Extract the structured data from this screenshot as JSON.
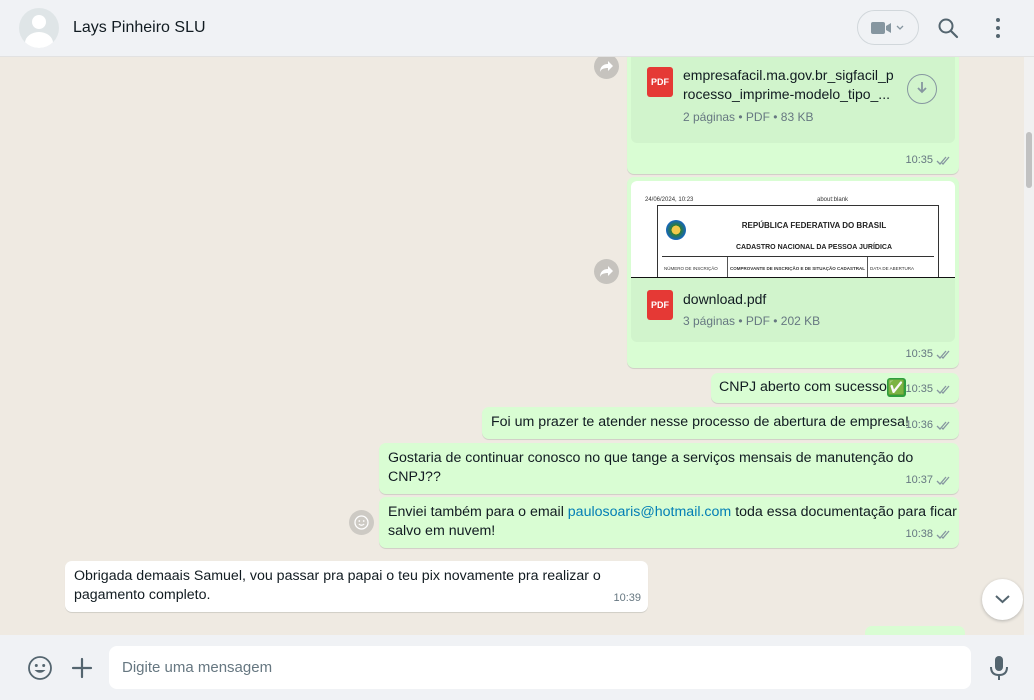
{
  "header": {
    "contact_name": "Lays Pinheiro SLU",
    "icons": [
      "avatar-icon",
      "video-call-icon",
      "search-icon",
      "menu-icon"
    ]
  },
  "messages": [
    {
      "type": "document",
      "direction": "outgoing",
      "file_name_line1": "empresafacil.ma.gov.br_sigfacil_p",
      "file_name_line2": "rocesso_imprime-modelo_tipo_...",
      "file_icon_label": "PDF",
      "file_info": "2 páginas • PDF • 83 KB",
      "time": "10:35"
    },
    {
      "type": "document",
      "direction": "outgoing",
      "preview": {
        "date": "24/06/2024, 10:23",
        "about": "about:blank",
        "title1": "REPÚBLICA FEDERATIVA DO BRASIL",
        "title2": "CADASTRO NACIONAL DA PESSOA JURÍDICA",
        "cell1": "NÚMERO DE INSCRIÇÃO 55.844.422/0001-88 MATRIZ",
        "cell2": "COMPROVANTE DE INSCRIÇÃO E DE SITUAÇÃO CADASTRAL",
        "cell3": "DATA DE ABERTURA 24/06/2024"
      },
      "file_name": "download.pdf",
      "file_icon_label": "PDF",
      "file_info": "3 páginas • PDF • 202 KB",
      "time": "10:35"
    },
    {
      "type": "text",
      "direction": "outgoing",
      "text": "CNPJ aberto com sucesso",
      "emoji": "✅",
      "time": "10:35"
    },
    {
      "type": "text",
      "direction": "outgoing",
      "text": "Foi um prazer te atender nesse processo de abertura de empresa!",
      "time": "10:36"
    },
    {
      "type": "text",
      "direction": "outgoing",
      "text_line1": "Gostaria de continuar conosco no que tange a serviços mensais de manutenção do",
      "text_line2": "CNPJ??",
      "time": "10:37"
    },
    {
      "type": "text",
      "direction": "outgoing",
      "text_before": "Enviei também para o email ",
      "link": "paulosoaris@hotmail.com",
      "text_after": " toda essa documentação para ficar",
      "text_line2": "salvo em nuvem!",
      "time": "10:38"
    },
    {
      "type": "text",
      "direction": "incoming",
      "text_line1": "Obrigada demaais Samuel, vou passar pra papai o teu pix novamente pra realizar o",
      "text_line2": "pagamento completo.",
      "time": "10:39"
    }
  ],
  "composer": {
    "placeholder": "Digite uma mensagem",
    "value": ""
  },
  "colors": {
    "outgoing_bubble": "#d9fdd3",
    "incoming_bubble": "#ffffff",
    "chat_background": "#efeae2",
    "link": "#027eb5",
    "pdf_icon": "#e53935"
  }
}
